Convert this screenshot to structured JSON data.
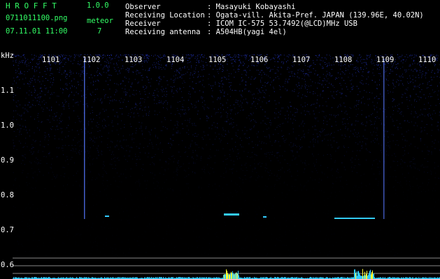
{
  "header": {
    "app_title": "H R O F F T",
    "version": "1.0.0",
    "filename": "0711011100.png",
    "datetime": "07.11.01 11:00",
    "meteor_label": "meteor",
    "meteor_count": "7",
    "info": [
      {
        "label": "Observer",
        "value": ": Masayuki Kobayashi"
      },
      {
        "label": "Receiving Location",
        "value": ": Ogata-vill. Akita-Pref. JAPAN (139.96E, 40.02N)"
      },
      {
        "label": "Receiver",
        "value": ": ICOM IC-575 53.7492(@LCD)MHz USB"
      },
      {
        "label": "Receiving antenna",
        "value": ": A504HB(yagi 4el)"
      }
    ]
  },
  "axes": {
    "y_unit": "kHz",
    "y_ticks": [
      "1.1",
      "1.0",
      "0.9",
      "0.8",
      "0.7",
      "0.6"
    ],
    "x_ticks": [
      "1101",
      "1102",
      "1103",
      "1104",
      "1105",
      "1106",
      "1107",
      "1108",
      "1109",
      "1110"
    ]
  },
  "colors": {
    "header_green": "#33ff66",
    "background": "#000000",
    "noise_blue": "#2233bb",
    "echo_cyan": "#33ccff",
    "echo_yellow": "#ffff33"
  }
}
